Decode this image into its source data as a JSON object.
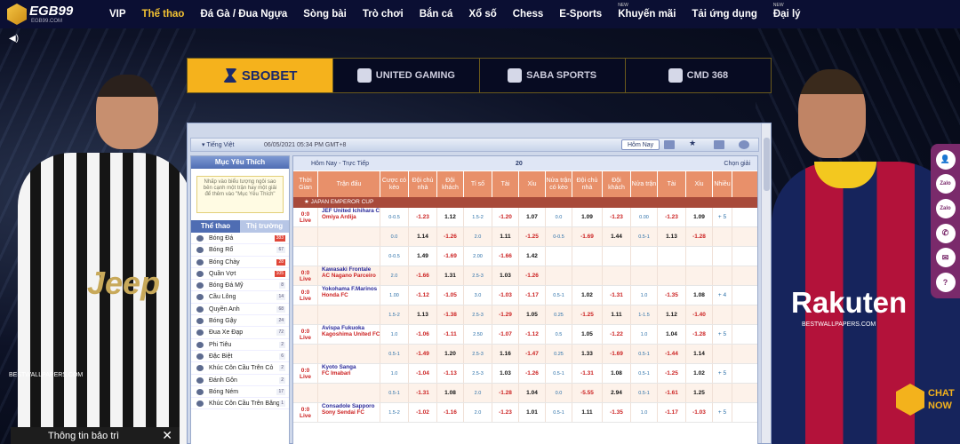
{
  "brand": {
    "name": "EGB99",
    "domain": "EGB99.COM"
  },
  "nav": [
    {
      "label": "VIP",
      "active": false,
      "tag": ""
    },
    {
      "label": "Thể thao",
      "active": true,
      "tag": ""
    },
    {
      "label": "Đá Gà / Đua Ngựa",
      "active": false,
      "tag": ""
    },
    {
      "label": "Sòng bài",
      "active": false,
      "tag": ""
    },
    {
      "label": "Trò chơi",
      "active": false,
      "tag": ""
    },
    {
      "label": "Bắn cá",
      "active": false,
      "tag": ""
    },
    {
      "label": "Xổ số",
      "active": false,
      "tag": ""
    },
    {
      "label": "Chess",
      "active": false,
      "tag": ""
    },
    {
      "label": "E-Sports",
      "active": false,
      "tag": ""
    },
    {
      "label": "Khuyến mãi",
      "active": false,
      "tag": "NEW"
    },
    {
      "label": "Tải ứng dụng",
      "active": false,
      "tag": ""
    },
    {
      "label": "Đại lý",
      "active": false,
      "tag": "NEW"
    }
  ],
  "providers": [
    "SBOBET",
    "UNITED GAMING",
    "SABA SPORTS",
    "CMD 368"
  ],
  "sportsbook": {
    "language": "Tiếng Việt",
    "datetime": "06/05/2021 05:34 PM GMT+8",
    "today_btn": "Hôm Nay",
    "favorites_title": "Mục Yêu Thích",
    "favorites_hint": "Nhấp vào biểu tượng ngôi sao bên cạnh một trận hay một giải để thêm vào \"Mục Yêu Thích\"",
    "tabs": [
      "Thể thao",
      "Thị trường"
    ],
    "sports": [
      {
        "name": "Bóng Đá",
        "count": "383",
        "hot": true
      },
      {
        "name": "Bóng Rổ",
        "count": "67",
        "hot": false
      },
      {
        "name": "Bóng Chày",
        "count": "28",
        "hot": true
      },
      {
        "name": "Quần Vợt",
        "count": "105",
        "hot": true
      },
      {
        "name": "Bóng Đá Mỹ",
        "count": "8",
        "hot": false
      },
      {
        "name": "Cầu Lông",
        "count": "14",
        "hot": false
      },
      {
        "name": "Quyền Anh",
        "count": "68",
        "hot": false
      },
      {
        "name": "Bóng Gậy",
        "count": "24",
        "hot": false
      },
      {
        "name": "Đua Xe Đạp",
        "count": "72",
        "hot": false
      },
      {
        "name": "Phi Tiêu",
        "count": "2",
        "hot": false
      },
      {
        "name": "Đặc Biệt",
        "count": "6",
        "hot": false
      },
      {
        "name": "Khúc Côn Cầu Trên Cỏ",
        "count": "2",
        "hot": false
      },
      {
        "name": "Đánh Gôn",
        "count": "2",
        "hot": false
      },
      {
        "name": "Bóng Ném",
        "count": "17",
        "hot": false
      },
      {
        "name": "Khúc Côn Cầu Trên Băng",
        "count": "1",
        "hot": false
      }
    ],
    "odds_header": {
      "title": "Hôm Nay - Trực Tiếp",
      "count": "20",
      "select": "Chọn giải"
    },
    "columns": [
      "Thời Gian",
      "Trận đấu",
      "Cược có kèo",
      "Đội chủ nhà",
      "Đội khách",
      "Tỉ số",
      "Tài",
      "Xỉu",
      "Nửa trận có kèo",
      "Đội chủ nhà",
      "Đội khách",
      "Nửa trận",
      "Tài",
      "Xỉu",
      "Nhiều"
    ],
    "league": "JAPAN EMPEROR CUP",
    "rows": [
      {
        "time": "0:0",
        "live": "Live",
        "home": "JEF United Ichihara Chiba",
        "away": "Omiya Ardija",
        "c": [
          "0-0.5",
          "-1.23",
          "1.12",
          "1.5-2",
          "-1.20",
          "1.07",
          "0.0",
          "1.09",
          "-1.23",
          "0.00",
          "-1.23",
          "1.09",
          "+ 5"
        ]
      },
      {
        "time": "",
        "live": "",
        "home": "",
        "away": "",
        "c": [
          "0.0",
          "1.14",
          "-1.26",
          "2.0",
          "1.11",
          "-1.25",
          "0-0.5",
          "-1.69",
          "1.44",
          "0.5-1",
          "1.13",
          "-1.28",
          ""
        ]
      },
      {
        "time": "",
        "live": "",
        "home": "",
        "away": "",
        "c": [
          "0-0.5",
          "1.49",
          "-1.69",
          "2.00",
          "-1.66",
          "1.42",
          "",
          "",
          "",
          "",
          "",
          "",
          ""
        ]
      },
      {
        "time": "0:0",
        "live": "Live",
        "home": "Kawasaki Frontale",
        "away": "AC Nagano Parceiro",
        "c": [
          "2.0",
          "-1.66",
          "1.31",
          "2.5-3",
          "1.03",
          "-1.26",
          "",
          "",
          "",
          "",
          "",
          "",
          ""
        ]
      },
      {
        "time": "0:0",
        "live": "Live",
        "home": "Yokohama F.Marinos",
        "away": "Honda FC",
        "c": [
          "1.00",
          "-1.12",
          "-1.05",
          "3.0",
          "-1.03",
          "-1.17",
          "0.5-1",
          "1.02",
          "-1.31",
          "1.0",
          "-1.35",
          "1.08",
          "+ 4"
        ]
      },
      {
        "time": "",
        "live": "",
        "home": "",
        "away": "",
        "c": [
          "1.5-2",
          "1.13",
          "-1.38",
          "2.5-3",
          "-1.29",
          "1.05",
          "0.25",
          "-1.25",
          "1.11",
          "1-1.5",
          "1.12",
          "-1.40",
          ""
        ]
      },
      {
        "time": "0:0",
        "live": "Live",
        "home": "Avispa Fukuoka",
        "away": "Kagoshima United FC",
        "c": [
          "1.0",
          "-1.06",
          "-1.11",
          "2.50",
          "-1.07",
          "-1.12",
          "0.5",
          "1.05",
          "-1.22",
          "1.0",
          "1.04",
          "-1.28",
          "+ 5"
        ]
      },
      {
        "time": "",
        "live": "",
        "home": "",
        "away": "",
        "c": [
          "0.5-1",
          "-1.49",
          "1.20",
          "2.5-3",
          "1.16",
          "-1.47",
          "0.25",
          "1.33",
          "-1.69",
          "0.5-1",
          "-1.44",
          "1.14",
          ""
        ]
      },
      {
        "time": "0:0",
        "live": "Live",
        "home": "Kyoto Sanga",
        "away": "FC Imabari",
        "c": [
          "1.0",
          "-1.04",
          "-1.13",
          "2.5-3",
          "1.03",
          "-1.26",
          "0.5-1",
          "-1.31",
          "1.08",
          "0.5-1",
          "-1.25",
          "1.02",
          "+ 5"
        ]
      },
      {
        "time": "",
        "live": "",
        "home": "",
        "away": "",
        "c": [
          "0.5-1",
          "-1.31",
          "1.08",
          "2.0",
          "-1.28",
          "1.04",
          "0.0",
          "-5.55",
          "2.94",
          "0.5-1",
          "-1.61",
          "1.25",
          ""
        ]
      },
      {
        "time": "0:0",
        "live": "Live",
        "home": "Consadole Sapporo",
        "away": "Sony Sendai FC",
        "c": [
          "1.5-2",
          "-1.02",
          "-1.16",
          "2.0",
          "-1.23",
          "1.01",
          "0.5-1",
          "1.11",
          "-1.35",
          "1.0",
          "-1.17",
          "-1.03",
          "+ 5"
        ]
      }
    ]
  },
  "watermark": "BESTWALLPAPERS.COM",
  "jersey_text": "Jeep",
  "sponsor_text": "Rakuten",
  "side_buttons": [
    "user-icon",
    "chat-icon",
    "chat2-icon",
    "phone-icon",
    "mail-icon",
    "help-icon"
  ],
  "chat_now": "CHAT NOW",
  "maintenance": "Thông tin bảo trì",
  "colors": {
    "nav_bg": "#0b0f33",
    "accent": "#f3c232",
    "provider_active": "#f5b21c",
    "odds_header": "#e8906a",
    "neg": "#cc2222"
  }
}
